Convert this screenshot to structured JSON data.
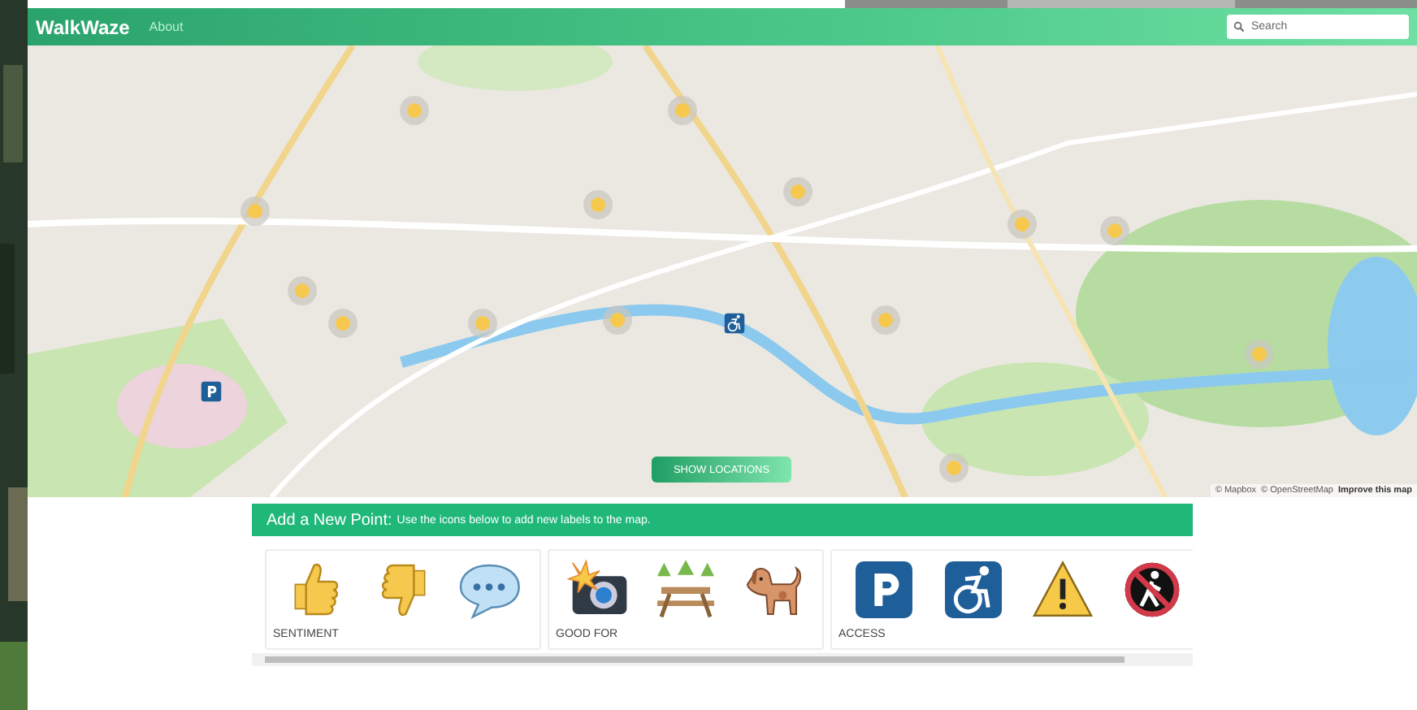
{
  "navbar": {
    "brand": "WalkWaze",
    "links": [
      {
        "label": "About"
      }
    ],
    "search": {
      "placeholder": "Search"
    }
  },
  "map": {
    "button": "SHOW LOCATIONS",
    "attribution": [
      {
        "kind": "text",
        "label": "© Mapbox"
      },
      {
        "kind": "text",
        "label": "© OpenStreetMap"
      },
      {
        "kind": "link",
        "label": "Improve this map"
      }
    ]
  },
  "add_point": {
    "title": "Add a New Point:",
    "hint": "Use the icons below to add new labels to the map.",
    "groups": [
      {
        "label": "SENTIMENT"
      },
      {
        "label": "GOOD FOR"
      },
      {
        "label": "ACCESS"
      }
    ]
  }
}
